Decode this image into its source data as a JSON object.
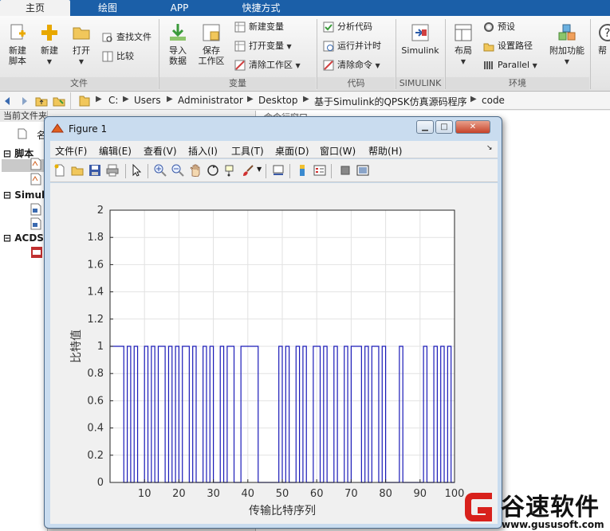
{
  "tabs": [
    {
      "label": "主页",
      "active": true
    },
    {
      "label": "绘图",
      "active": false
    },
    {
      "label": "APP",
      "active": false
    },
    {
      "label": "快捷方式",
      "active": false
    }
  ],
  "ribbon": {
    "file": {
      "new_script": "新建\n脚本",
      "new": "新建",
      "open": "打开",
      "find_files": "查找文件",
      "compare": "比较",
      "group": "文件"
    },
    "variable": {
      "import": "导入\n数据",
      "save_ws": "保存\n工作区",
      "new_var": "新建变量",
      "open_var": "打开变量",
      "clear_ws": "清除工作区",
      "group": "变量"
    },
    "code": {
      "analyze": "分析代码",
      "run_time": "运行并计时",
      "clear_cmd": "清除命令",
      "group": "代码"
    },
    "simulink": {
      "button": "Simulink",
      "group": "SIMULINK"
    },
    "env": {
      "layout": "布局",
      "prefs": "预设",
      "set_path": "设置路径",
      "parallel": "Parallel",
      "addons": "附加功能",
      "group": "环境"
    },
    "help_partial": "帮"
  },
  "address": {
    "crumbs": [
      "C:",
      "Users",
      "Administrator",
      "Desktop",
      "基于Simulink的QPSK仿真源码程序",
      "code"
    ]
  },
  "left_panel": {
    "title": "当前文件夹",
    "name_col": "名",
    "groups": [
      "脚本",
      "Simul",
      "ACDS"
    ]
  },
  "command_window": {
    "title": "命令行窗口"
  },
  "figure": {
    "title": "Figure 1",
    "menu": [
      "文件(F)",
      "编辑(E)",
      "查看(V)",
      "插入(I)",
      "工具(T)",
      "桌面(D)",
      "窗口(W)",
      "帮助(H)"
    ],
    "toolbar_icons": [
      "new-figure-icon",
      "open-file-icon",
      "save-icon",
      "print-icon",
      "pointer-icon",
      "zoom-in-icon",
      "zoom-out-icon",
      "pan-icon",
      "rotate-icon",
      "data-cursor-icon",
      "brush-icon",
      "link-icon",
      "colorbar-icon",
      "legend-icon",
      "hide-plot-tools-icon",
      "show-plot-tools-icon"
    ]
  },
  "chart_data": {
    "type": "line",
    "style": "step",
    "color": "#1a1ab8",
    "grid": true,
    "xlabel": "传输比特序列",
    "ylabel": "比特值",
    "xlim": [
      0,
      100
    ],
    "ylim": [
      0,
      2
    ],
    "xticks": [
      10,
      20,
      30,
      40,
      50,
      60,
      70,
      80,
      90,
      100
    ],
    "yticks": [
      0,
      0.2,
      0.4,
      0.6,
      0.8,
      1,
      1.2,
      1.4,
      1.6,
      1.8,
      2
    ],
    "bits": [
      1,
      1,
      1,
      1,
      0,
      1,
      0,
      1,
      0,
      0,
      1,
      0,
      1,
      0,
      1,
      1,
      0,
      1,
      0,
      1,
      0,
      1,
      1,
      0,
      1,
      0,
      0,
      1,
      0,
      1,
      0,
      0,
      1,
      0,
      1,
      1,
      0,
      0,
      1,
      1,
      1,
      1,
      1,
      0,
      0,
      0,
      0,
      0,
      0,
      1,
      0,
      1,
      0,
      0,
      1,
      0,
      1,
      0,
      0,
      1,
      1,
      0,
      1,
      0,
      0,
      1,
      0,
      0,
      1,
      0,
      1,
      1,
      1,
      0,
      1,
      0,
      1,
      1,
      0,
      1,
      0,
      0,
      0,
      0,
      1,
      0,
      0,
      0,
      0,
      0,
      0,
      1,
      0,
      0,
      1,
      0,
      1,
      0,
      1,
      0
    ]
  },
  "watermark": {
    "text": "谷速软件",
    "url": "www.gususoft.com"
  }
}
